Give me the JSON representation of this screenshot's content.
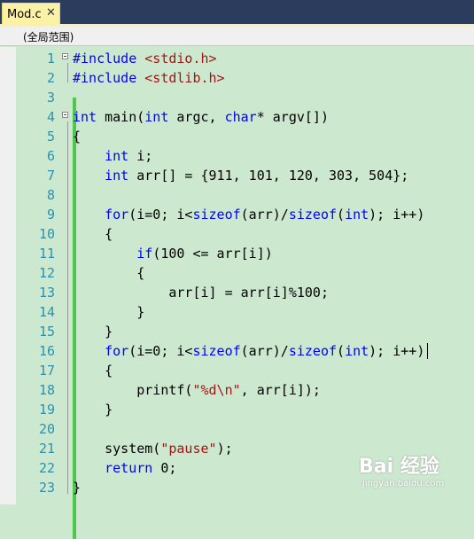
{
  "tab": {
    "title": "Mod.c",
    "close": "✕"
  },
  "navbar": {
    "scope": "(全局范围)"
  },
  "editor": {
    "lines": [
      {
        "n": "1",
        "html": "<span class=\"pp\">#include</span> <span class=\"inc\">&lt;stdio.h&gt;</span>"
      },
      {
        "n": "2",
        "html": "<span class=\"pp\">#include</span> <span class=\"inc\">&lt;stdlib.h&gt;</span>"
      },
      {
        "n": "3",
        "html": ""
      },
      {
        "n": "4",
        "html": "<span class=\"kw\">int</span> main(<span class=\"kw\">int</span> argc, <span class=\"kw\">char</span>* argv[])"
      },
      {
        "n": "5",
        "html": "{"
      },
      {
        "n": "6",
        "html": "    <span class=\"kw\">int</span> i;"
      },
      {
        "n": "7",
        "html": "    <span class=\"kw\">int</span> arr[] = {911, 101, 120, 303, 504};"
      },
      {
        "n": "8",
        "html": ""
      },
      {
        "n": "9",
        "html": "    <span class=\"kw\">for</span>(i=0; i&lt;<span class=\"kw\">sizeof</span>(arr)/<span class=\"kw\">sizeof</span>(<span class=\"kw\">int</span>); i++)"
      },
      {
        "n": "10",
        "html": "    {"
      },
      {
        "n": "11",
        "html": "        <span class=\"kw\">if</span>(100 &lt;= arr[i])"
      },
      {
        "n": "12",
        "html": "        {"
      },
      {
        "n": "13",
        "html": "            arr[i] = arr[i]%100;"
      },
      {
        "n": "14",
        "html": "        }"
      },
      {
        "n": "15",
        "html": "    }"
      },
      {
        "n": "16",
        "html": "    <span class=\"kw\">for</span>(i=0; i&lt;<span class=\"kw\">sizeof</span>(arr)/<span class=\"kw\">sizeof</span>(<span class=\"kw\">int</span>); i++)"
      },
      {
        "n": "17",
        "html": "    {"
      },
      {
        "n": "18",
        "html": "        printf(<span class=\"str\">\"%d\\n\"</span>, arr[i]);"
      },
      {
        "n": "19",
        "html": "    }"
      },
      {
        "n": "20",
        "html": ""
      },
      {
        "n": "21",
        "html": "    system(<span class=\"str\">\"pause\"</span>);"
      },
      {
        "n": "22",
        "html": "    <span class=\"kw\">return</span> 0;"
      },
      {
        "n": "23",
        "html": "}"
      }
    ],
    "fold_lines": [
      "1",
      "4"
    ]
  },
  "watermark": {
    "logo": "Bai 经验",
    "sub": "jingyan.baidu.com"
  },
  "colors": {
    "editor_bg": "#cce8cf",
    "keyword": "#0000ff",
    "string": "#a31515",
    "line_number": "#2b91af",
    "tab_bg": "#fbf2a8",
    "change_bar": "#4fc74f"
  }
}
